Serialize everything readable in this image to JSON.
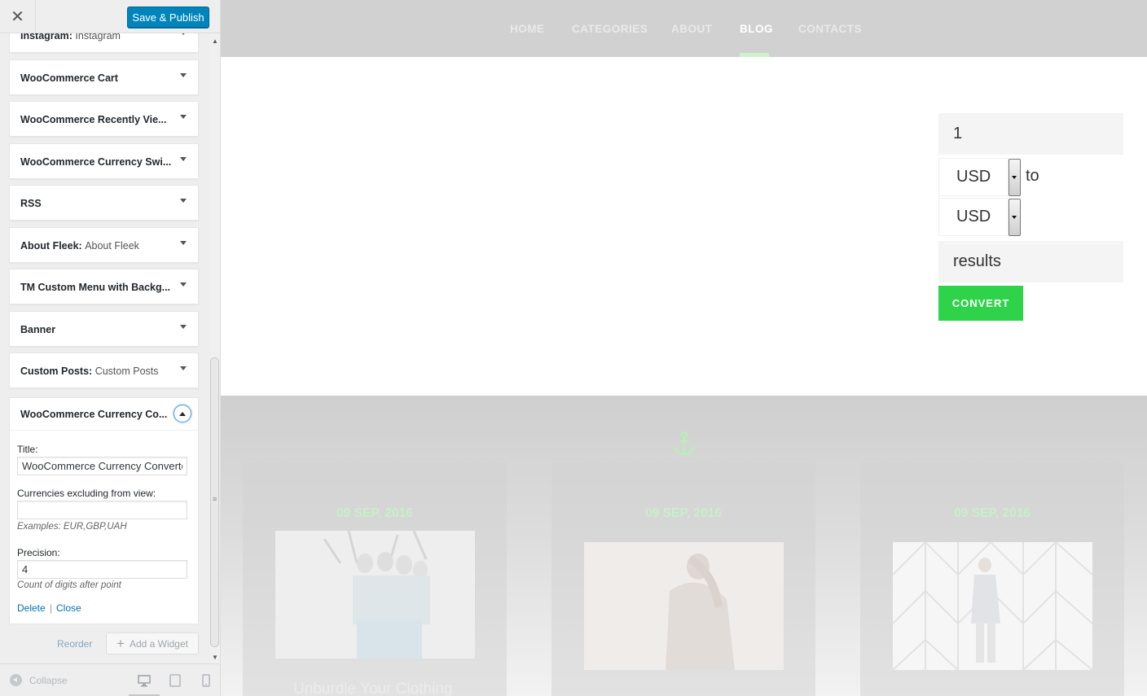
{
  "toolbar": {
    "close_glyph": "✕",
    "save_label": "Save & Publish"
  },
  "widgets": [
    {
      "title": "Instagram:",
      "subtitle": "Instagram"
    },
    {
      "title": "WooCommerce Cart",
      "subtitle": ""
    },
    {
      "title": "WooCommerce Recently Vie...",
      "subtitle": ""
    },
    {
      "title": "WooCommerce Currency Swi...",
      "subtitle": ""
    },
    {
      "title": "RSS",
      "subtitle": ""
    },
    {
      "title": "About Fleek:",
      "subtitle": "About Fleek"
    },
    {
      "title": "TM Custom Menu with Backg...",
      "subtitle": ""
    },
    {
      "title": "Banner",
      "subtitle": ""
    },
    {
      "title": "Custom Posts:",
      "subtitle": "Custom Posts"
    }
  ],
  "open_widget": {
    "title": "WooCommerce Currency Co...",
    "title_label": "Title:",
    "title_value": "WooCommerce Currency Converter",
    "excl_label": "Currencies excluding from view:",
    "excl_value": "",
    "excl_example": "Examples: EUR,GBP,UAH",
    "precision_label": "Precision:",
    "precision_value": "4",
    "precision_desc": "Count of digits after point",
    "delete_label": "Delete",
    "separator": "|",
    "close_label": "Close"
  },
  "panel_actions": {
    "reorder_label": "Reorder",
    "add_widget_label": "Add a Widget",
    "add_icon": "plus-icon"
  },
  "footer": {
    "collapse_label": "Collapse"
  },
  "site_nav": {
    "items": [
      "HOME",
      "CATEGORIES",
      "ABOUT",
      "BLOG",
      "CONTACTS"
    ],
    "active": "BLOG"
  },
  "converter": {
    "amount": "1",
    "from_currency": "USD",
    "to_label": "to",
    "to_currency": "USD",
    "results_label": "results",
    "convert_label": "CONVERT"
  },
  "posts": {
    "items": [
      {
        "date": "09 SEP, 2016"
      },
      {
        "date": "09 SEP, 2016"
      },
      {
        "date": "09 SEP, 2016"
      }
    ],
    "first_title": "Unburdle Your Clothing"
  },
  "colors": {
    "accent_green": "#2ed34a",
    "wp_blue": "#0085ba",
    "nav_bg": "#d1d1d1",
    "active_underline": "#ccf3cc"
  }
}
